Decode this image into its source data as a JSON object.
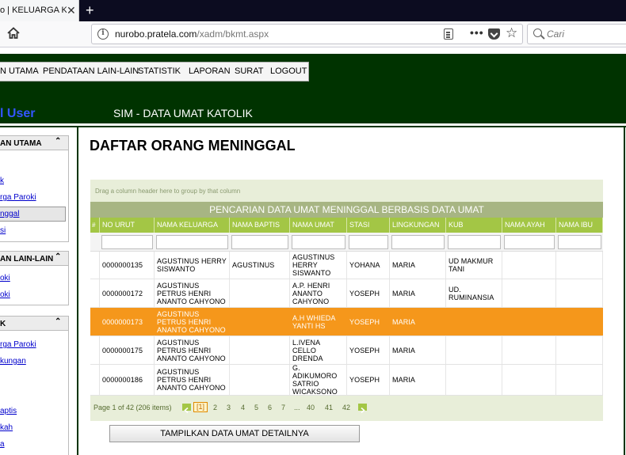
{
  "browser": {
    "tab_title": "o | KELUARGA KATO",
    "tab_close": "✕",
    "new_tab": "+",
    "url_host": "nurobo.pratela.com",
    "url_path": "/xadm/bkmt.aspx",
    "search_placeholder": "Cari"
  },
  "menu": {
    "items": [
      "N UTAMA",
      "PENDATAAN LAIN-LAIN",
      "STATISTIK",
      "LAPORAN",
      "SURAT",
      "LOGOUT"
    ]
  },
  "header": {
    "user_label": "l User",
    "title": "SIM - DATA UMAT KATOLIK"
  },
  "sidebar": {
    "panels": [
      {
        "title": "AN UTAMA",
        "chevron": "⌃",
        "links": [
          "k",
          "rga Paroki",
          "nggal",
          "si"
        ],
        "selected": 2
      },
      {
        "title": "AN LAIN-LAIN",
        "chevron": "⌃",
        "links": [
          "oki",
          "oki"
        ]
      },
      {
        "title": "K",
        "chevron": "⌃",
        "links": [
          "rga Paroki",
          "kungan",
          "aptis",
          "kah",
          "a"
        ]
      }
    ]
  },
  "main": {
    "title": "DAFTAR ORANG MENINGGAL",
    "group_hint": "Drag a column header here to group by that column",
    "caption": "PENCARIAN DATA UMAT MENINGGAL BERBASIS DATA UMAT",
    "columns": [
      "#",
      "NO URUT",
      "NAMA KELUARGA",
      "NAMA BAPTIS",
      "NAMA UMAT",
      "STASI",
      "LINGKUNGAN",
      "KUB",
      "NAMA AYAH",
      "NAMA IBU"
    ],
    "rows": [
      {
        "no": "0000000135",
        "keluarga": "AGUSTINUS HERRY SISWANTO",
        "baptis": "AGUSTINUS",
        "umat": "AGUSTINUS HERRY SISWANTO",
        "stasi": "YOHANA",
        "lingkungan": "MARIA",
        "kub": "UD MAKMUR TANI",
        "ayah": "",
        "ibu": ""
      },
      {
        "no": "0000000172",
        "keluarga": "AGUSTINUS PETRUS HENRI ANANTO CAHYONO",
        "baptis": "",
        "umat": "A.P. HENRI ANANTO CAHYONO",
        "stasi": "YOSEPH",
        "lingkungan": "MARIA",
        "kub": "UD. RUMINANSIA",
        "ayah": "",
        "ibu": ""
      },
      {
        "no": "0000000173",
        "keluarga": "AGUSTINUS PETRUS HENRI ANANTO CAHYONO",
        "baptis": "",
        "umat": "A.H WHIEDA YANTI HS",
        "stasi": "YOSEPH",
        "lingkungan": "MARIA",
        "kub": "",
        "ayah": "",
        "ibu": ""
      },
      {
        "no": "0000000175",
        "keluarga": "AGUSTINUS PETRUS HENRI ANANTO CAHYONO",
        "baptis": "",
        "umat": "L.IVENA CELLO DRENDA",
        "stasi": "YOSEPH",
        "lingkungan": "MARIA",
        "kub": "",
        "ayah": "",
        "ibu": ""
      },
      {
        "no": "0000000186",
        "keluarga": "AGUSTINUS PETRUS HENRI ANANTO CAHYONO",
        "baptis": "",
        "umat": "G. ADIKUMORO SATRIO WICAKSONO",
        "stasi": "YOSEPH",
        "lingkungan": "MARIA",
        "kub": "",
        "ayah": "",
        "ibu": ""
      }
    ],
    "selected_row": 2,
    "pager": {
      "summary": "Page 1 of 42 (206 items)",
      "current": "[1]",
      "pages": [
        "2",
        "3",
        "4",
        "5",
        "6",
        "7",
        "...",
        "40",
        "41",
        "42"
      ]
    },
    "detail_button": "TAMPILKAN DATA UMAT DETAILNYA"
  },
  "colors": {
    "header_bg": "#003300",
    "grid_header": "#a3c645",
    "caption_bg": "#a7b583",
    "selected_row": "#f5971b"
  }
}
